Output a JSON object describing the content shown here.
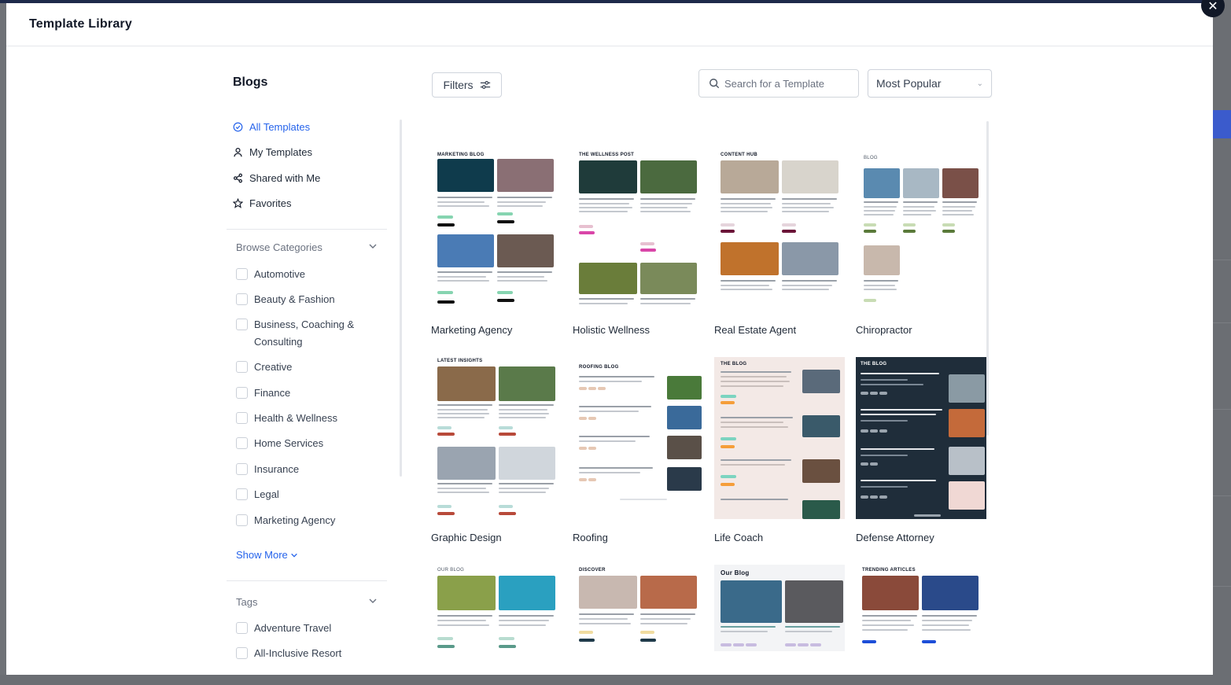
{
  "modal": {
    "title": "Template Library",
    "close_icon": "close-icon"
  },
  "section_title": "Blogs",
  "toolbar": {
    "filters_label": "Filters",
    "search_placeholder": "Search for a Template",
    "sort_value": "Most Popular"
  },
  "sidebar": {
    "nav": [
      {
        "label": "All Templates",
        "icon": "check-circle-icon",
        "active": true
      },
      {
        "label": "My Templates",
        "icon": "user-icon",
        "active": false
      },
      {
        "label": "Shared with Me",
        "icon": "share-icon",
        "active": false
      },
      {
        "label": "Favorites",
        "icon": "star-icon",
        "active": false
      }
    ],
    "categories_title": "Browse Categories",
    "categories": [
      "Automotive",
      "Beauty & Fashion",
      "Business, Coaching & Consulting",
      "Creative",
      "Finance",
      "Health & Wellness",
      "Home Services",
      "Insurance",
      "Legal",
      "Marketing Agency"
    ],
    "show_more": "Show More",
    "tags_title": "Tags",
    "tags": [
      "Adventure Travel",
      "All-Inclusive Resort"
    ]
  },
  "templates": [
    {
      "name": "Marketing Agency",
      "preview_title": "MARKETING BLOG",
      "theme": "light"
    },
    {
      "name": "Holistic Wellness",
      "preview_title": "THE WELLNESS POST",
      "theme": "light"
    },
    {
      "name": "Real Estate Agent",
      "preview_title": "CONTENT HUB",
      "theme": "light"
    },
    {
      "name": "Chiropractor",
      "preview_title": "BLOG",
      "theme": "light"
    },
    {
      "name": "Graphic Design",
      "preview_title": "LATEST INSIGHTS",
      "theme": "light"
    },
    {
      "name": "Roofing",
      "preview_title": "ROOFING BLOG",
      "theme": "light"
    },
    {
      "name": "Life Coach",
      "preview_title": "THE BLOG",
      "theme": "blush"
    },
    {
      "name": "Defense Attorney",
      "preview_title": "THE BLOG",
      "theme": "dark"
    },
    {
      "name": "",
      "preview_title": "OUR BLOG",
      "theme": "light"
    },
    {
      "name": "",
      "preview_title": "DISCOVER",
      "theme": "light"
    },
    {
      "name": "",
      "preview_title": "Our Blog",
      "theme": "light"
    },
    {
      "name": "",
      "preview_title": "TRENDING ARTICLES",
      "theme": "light"
    }
  ],
  "colors": {
    "accent": "#2563eb",
    "modal_bg": "#ffffff",
    "overlay": "#6f7277",
    "dark_card": "#1f2d3a",
    "blush_card": "#f3e9e6"
  }
}
